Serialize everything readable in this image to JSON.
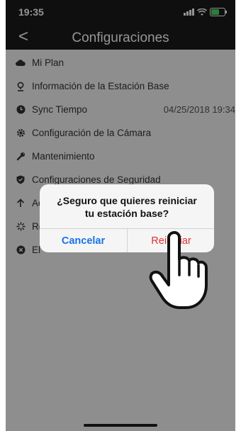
{
  "status_bar": {
    "time": "19:35"
  },
  "nav": {
    "back_glyph": "<",
    "title": "Configuraciones"
  },
  "menu": {
    "items": [
      {
        "label": "Mi Plan",
        "icon": "cloud-icon"
      },
      {
        "label": "Información de la Estación Base",
        "icon": "location-pin-icon"
      },
      {
        "label": "Sync Tiempo",
        "icon": "clock-icon",
        "value": "04/25/2018 19:34"
      },
      {
        "label": "Configuración de la Cámara",
        "icon": "gear-icon"
      },
      {
        "label": "Mantenimiento",
        "icon": "wrench-icon"
      },
      {
        "label": "Configuraciones de Seguridad",
        "icon": "shield-icon"
      },
      {
        "label": "Ac",
        "icon": "arrow-up-icon"
      },
      {
        "label": "Re",
        "icon": "spinner-icon"
      },
      {
        "label": "El",
        "icon": "close-circle-icon"
      }
    ]
  },
  "dialog": {
    "message_line1": "¿Seguro que quieres reiniciar",
    "message_line2": "tu estación base?",
    "cancel_label": "Cancelar",
    "confirm_label": "Reiniciar"
  },
  "colors": {
    "cancel": "#1a73e8",
    "confirm": "#e03030",
    "header": "#1a1a1a",
    "battery": "#4cd964"
  }
}
